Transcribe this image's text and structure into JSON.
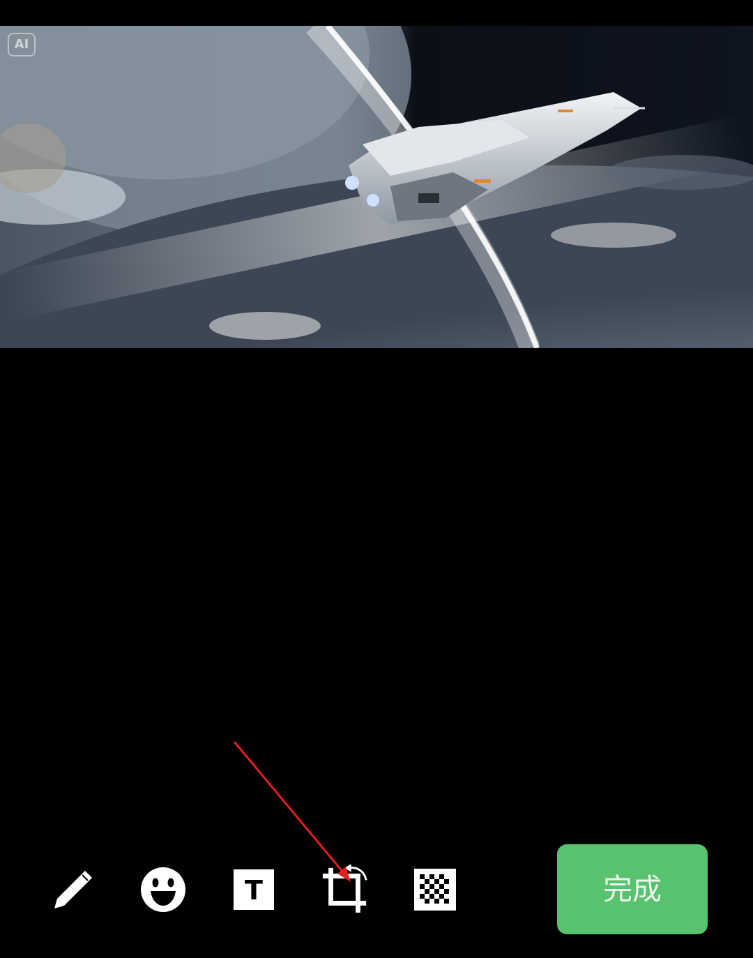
{
  "photo": {
    "ai_badge": "AI",
    "alt_subject": "spaceship-over-planet"
  },
  "toolbar": {
    "tools": [
      {
        "name": "pencil-icon",
        "label": "draw"
      },
      {
        "name": "emoji-icon",
        "label": "sticker"
      },
      {
        "name": "text-icon",
        "label": "T"
      },
      {
        "name": "crop-rotate-icon",
        "label": "crop"
      },
      {
        "name": "mosaic-icon",
        "label": "mosaic"
      }
    ],
    "done_label": "完成"
  },
  "colors": {
    "background": "#000000",
    "done_button": "#59c26e",
    "icon": "#ffffff",
    "annotation_arrow": "#e02020"
  }
}
